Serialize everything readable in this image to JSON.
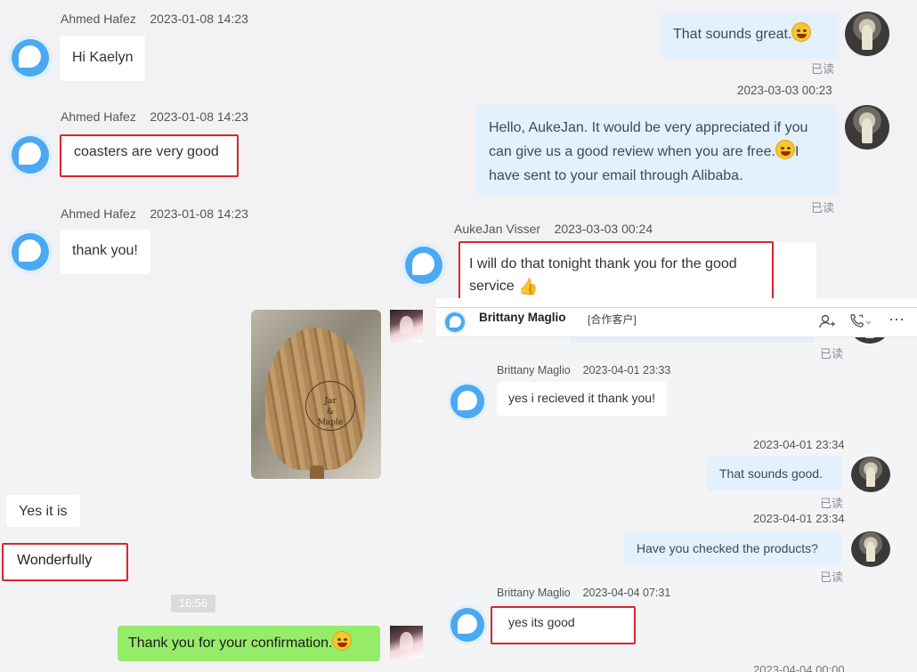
{
  "panel1": {
    "left_messages": [
      {
        "sender": "Ahmed Hafez",
        "time": "2023-01-08 14:23",
        "text": "Hi Kaelyn"
      },
      {
        "sender": "Ahmed Hafez",
        "time": "2023-01-08 14:23",
        "text": "coasters are very good"
      },
      {
        "sender": "Ahmed Hafez",
        "time": "2023-01-08 14:23",
        "text": "thank you!"
      }
    ],
    "right_messages": [
      {
        "text": "That sounds great.",
        "read": "已读"
      },
      {
        "timestamp": "2023-03-03 00:23",
        "text_lines": [
          "Hello, AukeJan. It would be very appreciated if you",
          "can give us a good review when you are free.",
          "I",
          "have sent to your email through Alibaba."
        ],
        "read": "已读"
      }
    ],
    "reply": {
      "sender": "AukeJan Visser",
      "time": "2023-03-03 00:24",
      "text_lines": [
        "I will do that tonight thank you for the good",
        "service"
      ]
    }
  },
  "panel2": {
    "image_logo_lines": [
      "Jar",
      "&",
      "Maple"
    ],
    "messages": [
      "Yes it is",
      "Wonderfully"
    ],
    "time_chip": "16:56",
    "own_message": "Thank you for your confirmation."
  },
  "panel3": {
    "header": {
      "name": "Brittany Maglio",
      "tag": "[合作客户]"
    },
    "top_read": "已读",
    "messages": [
      {
        "side": "left",
        "sender": "Brittany Maglio",
        "time": "2023-04-01 23:33",
        "text": "yes i recieved it thank you!"
      },
      {
        "side": "right",
        "timestamp": "2023-04-01 23:34",
        "text": "That sounds good.",
        "read": "已读"
      },
      {
        "side": "right",
        "timestamp": "2023-04-01 23:34",
        "text": "Have you checked the products?",
        "read": "已读"
      },
      {
        "side": "left",
        "sender": "Brittany Maglio",
        "time": "2023-04-04 07:31",
        "text": "yes its good"
      }
    ],
    "bottom_timestamp_partial": "2023-04-04 00:00"
  },
  "icons": [
    "user-add-icon",
    "phone-icon",
    "more-icon",
    "smile-emoji-icon",
    "thumbs-up-icon"
  ],
  "colors": {
    "highlight_border": "#d9262c",
    "own_bubble_blue": "#e3f0fd",
    "own_bubble_green": "#95ec69",
    "avatar_blue": "#4aa9f2"
  }
}
